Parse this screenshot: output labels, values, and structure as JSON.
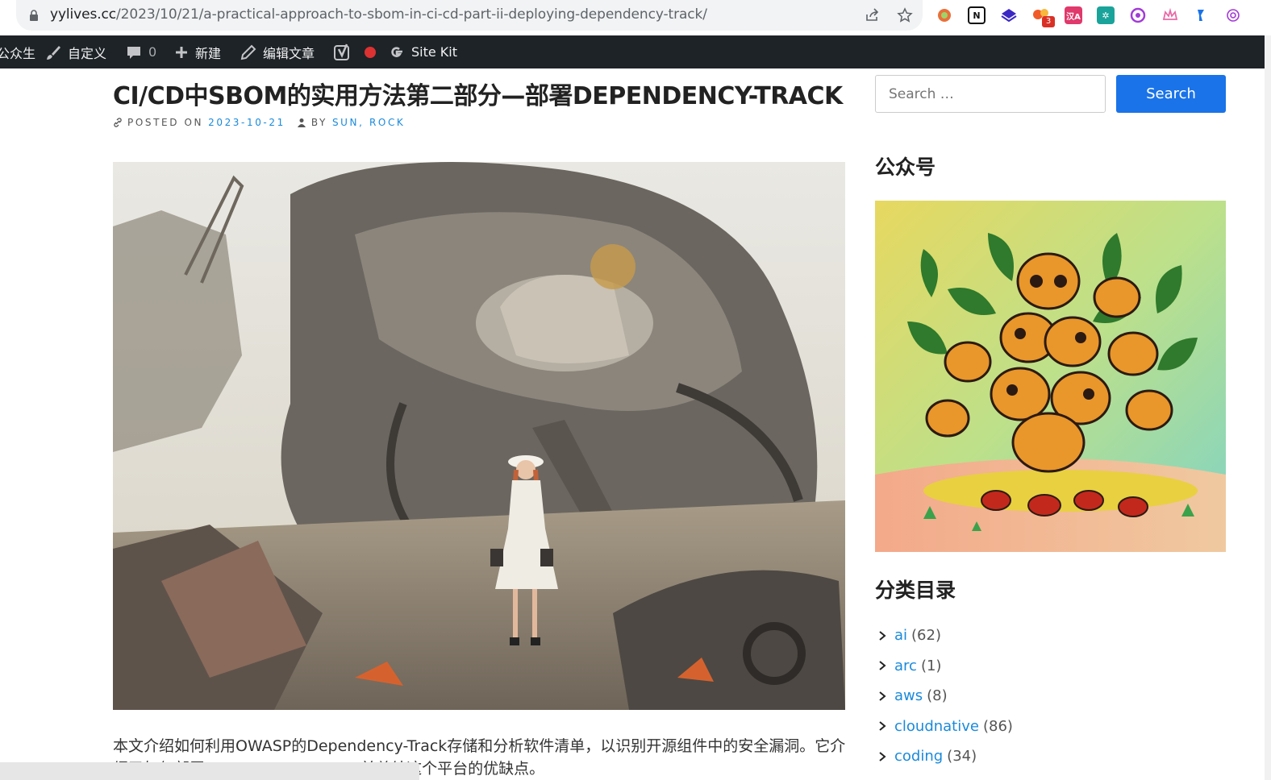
{
  "browser": {
    "url_host": "yylives.cc",
    "url_path": "/2023/10/21/a-practical-approach-to-sbom-in-ci-cd-part-ii-deploying-dependency-track/",
    "extension_badge": "3",
    "extensions": [
      "circle-ext-icon",
      "notion-icon",
      "layers-icon",
      "red-dots-ext-icon",
      "translate-ext-icon",
      "grid-ext-icon",
      "purple-circle-ext-icon",
      "crown-ext-icon",
      "blue-ext-icon",
      "openai-icon"
    ]
  },
  "adminbar": {
    "site_name": "公众生",
    "customize": "自定义",
    "comments_count": "0",
    "new": "新建",
    "edit_post": "编辑文章",
    "sitekit": "Site Kit"
  },
  "post": {
    "title": "CI/CD中SBOM的实用方法第二部分—部署DEPENDENCY-TRACK",
    "posted_on_label": "POSTED ON",
    "date": "2023-10-21",
    "by_label": "BY",
    "author": "SUN, ROCK",
    "excerpt": "本文介绍如何利用OWASP的Dependency-Track存储和分析软件清单，以识别开源组件中的安全漏洞。它介绍了如何部署Dependency-Track，并总结这个平台的优缺点。"
  },
  "sidebar": {
    "search_placeholder": "Search …",
    "search_button": "Search",
    "wechat_title": "公众号",
    "categories_title": "分类目录",
    "categories": [
      {
        "name": "ai",
        "count": "(62)"
      },
      {
        "name": "arc",
        "count": "(1)"
      },
      {
        "name": "aws",
        "count": "(8)"
      },
      {
        "name": "cloudnative",
        "count": "(86)"
      },
      {
        "name": "coding",
        "count": "(34)"
      }
    ]
  }
}
